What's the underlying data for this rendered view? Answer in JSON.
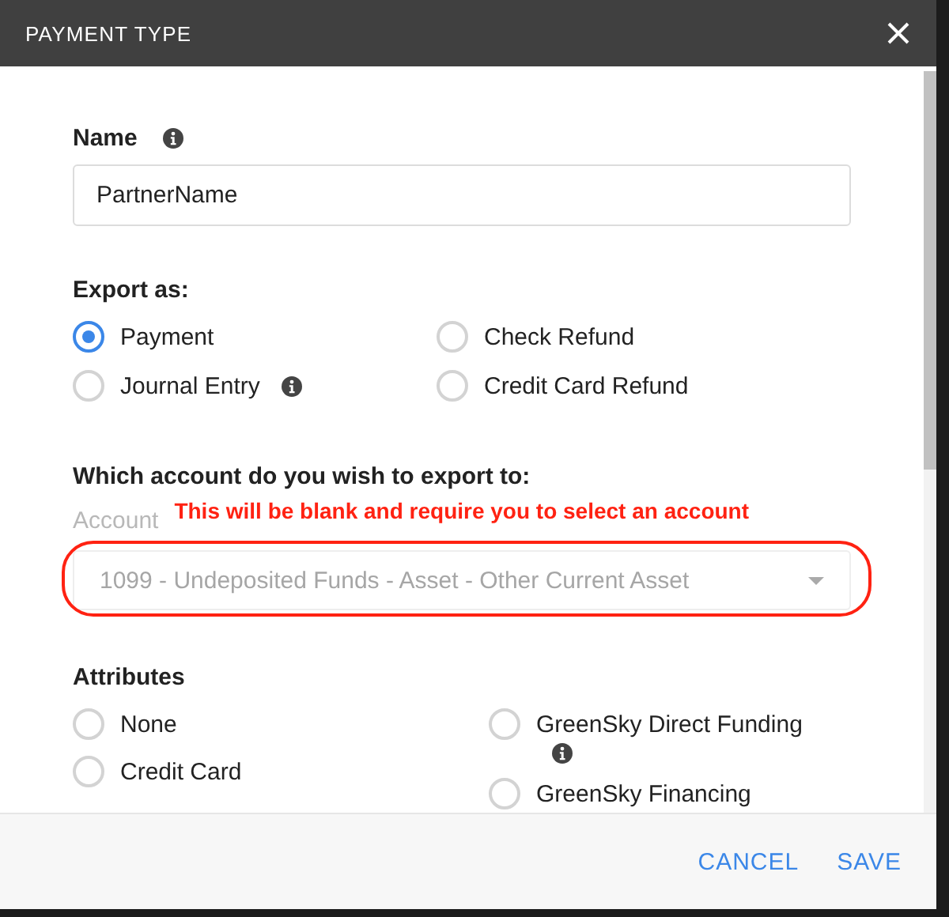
{
  "dialog": {
    "title": "PAYMENT TYPE"
  },
  "name_field": {
    "label": "Name",
    "value": "PartnerName"
  },
  "export_as": {
    "label": "Export as:",
    "options": [
      {
        "label": "Payment",
        "selected": true,
        "info": false
      },
      {
        "label": "Check Refund",
        "selected": false,
        "info": false
      },
      {
        "label": "Journal Entry",
        "selected": false,
        "info": true
      },
      {
        "label": "Credit Card Refund",
        "selected": false,
        "info": false
      }
    ]
  },
  "account": {
    "question": "Which account do you wish to export to:",
    "label": "Account",
    "value": "1099 - Undeposited Funds - Asset - Other Current Asset",
    "disabled": true
  },
  "annotation": {
    "text": "This will be blank and require you to select an account"
  },
  "attributes": {
    "label": "Attributes",
    "columns": [
      [
        {
          "label": "None",
          "selected": false,
          "info": false
        },
        {
          "label": "Credit Card",
          "selected": false,
          "info": false
        }
      ],
      [
        {
          "label": "GreenSky Direct Funding",
          "selected": false,
          "info": true
        },
        {
          "label": "GreenSky Financing",
          "selected": false,
          "info": false
        }
      ]
    ]
  },
  "buttons": [
    {
      "label": "CANCEL"
    },
    {
      "label": "SAVE"
    }
  ]
}
